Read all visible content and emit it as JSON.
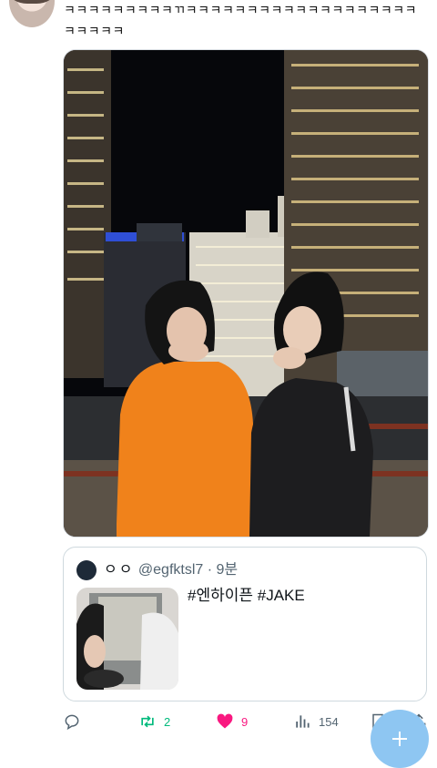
{
  "tweet": {
    "text": "ㅋㅋㅋㅋㅋㅋㅋㅋㅋㄲㅋㅋㅋㅋㅋㅋㅋㅋㅋㅋㅋㅋㅋㅋㅋㅋㅋㅋㅋㅋㅋㅋㅋㅋ"
  },
  "quote": {
    "name": "ㅇㅇ",
    "handle": "@egfktsl7",
    "separator": "·",
    "time": "9분",
    "text": "#엔하이픈 #JAKE"
  },
  "actions": {
    "retweets": "2",
    "likes": "9",
    "views": "154"
  },
  "colors": {
    "retweet": "#00ba7c",
    "like": "#f91880",
    "icon": "#536471",
    "fab": "#8ec6f2"
  },
  "icons": [
    "reply-icon",
    "retweet-icon",
    "heart-icon",
    "views-icon",
    "bookmark-icon",
    "share-icon",
    "compose-plus-icon"
  ]
}
